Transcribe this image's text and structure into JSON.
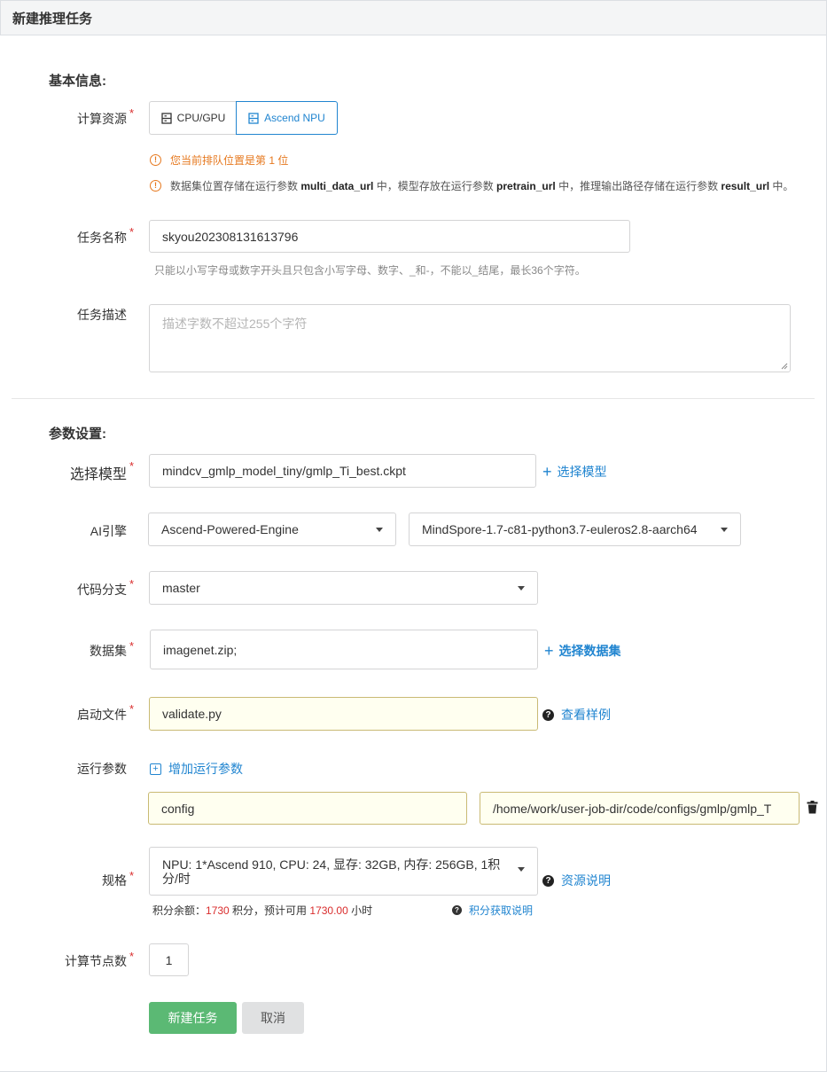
{
  "header": {
    "title": "新建推理任务"
  },
  "basic": {
    "section_title": "基本信息:",
    "resource_label": "计算资源",
    "required_mark": "*",
    "resource_options": [
      "CPU/GPU",
      "Ascend NPU"
    ],
    "selected_resource": "Ascend NPU",
    "queue_notice": "您当前排队位置是第 1 位",
    "dataset_notice": {
      "p1": "数据集位置存储在运行参数 ",
      "b1": "multi_data_url",
      "p2": " 中，模型存放在运行参数 ",
      "b2": "pretrain_url",
      "p3": " 中，推理输出路径存储在运行参数 ",
      "b3": "result_url",
      "p4": " 中。"
    },
    "name_label": "任务名称",
    "name_value": "skyou202308131613796",
    "name_hint": "只能以小写字母或数字开头且只包含小写字母、数字、_和-，不能以_结尾，最长36个字符。",
    "desc_label": "任务描述",
    "desc_placeholder": "描述字数不超过255个字符"
  },
  "params": {
    "section_title": "参数设置:",
    "model_label": "选择模型",
    "model_value": "mindcv_gmlp_model_tiny/gmlp_Ti_best.ckpt",
    "model_link": "选择模型",
    "engine_label": "AI引擎",
    "engine_value": "Ascend-Powered-Engine",
    "engine_version": "MindSpore-1.7-c81-python3.7-euleros2.8-aarch64",
    "branch_label": "代码分支",
    "branch_value": "master",
    "dataset_label": "数据集",
    "dataset_value": "imagenet.zip;",
    "dataset_link": "选择数据集",
    "boot_label": "启动文件",
    "boot_value": "validate.py",
    "boot_link": "查看样例",
    "run_params_label": "运行参数",
    "add_param_link": "增加运行参数",
    "param_key": "config",
    "param_value": "/home/work/user-job-dir/code/configs/gmlp/gmlp_T",
    "spec_label": "规格",
    "spec_value": "NPU: 1*Ascend 910, CPU: 24, 显存: 32GB, 内存: 256GB, 1积分/时",
    "spec_link": "资源说明",
    "points": {
      "prefix": "积分余额：",
      "balance": "1730",
      "mid": " 积分，预计可用 ",
      "hours": "1730.00",
      "suffix": " 小时"
    },
    "points_link": "积分获取说明",
    "nodes_label": "计算节点数",
    "nodes_value": "1"
  },
  "actions": {
    "submit": "新建任务",
    "cancel": "取消"
  },
  "colors": {
    "accent": "#2185d0",
    "warning": "#e6781e",
    "required": "#d92d2d",
    "submit": "#5bb974"
  },
  "icons": [
    "server-icon",
    "warning-circle-icon",
    "plus-icon",
    "caret-down-icon",
    "question-circle-icon",
    "add-box-icon",
    "trash-icon"
  ]
}
